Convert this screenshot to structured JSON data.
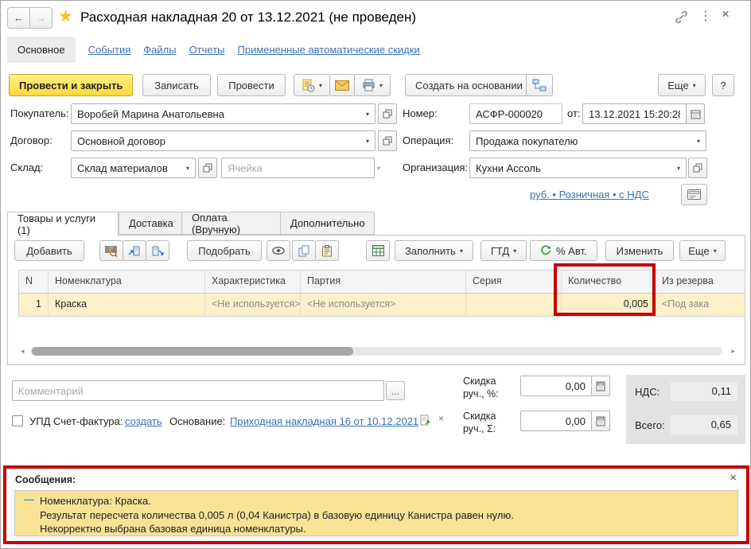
{
  "icons": {
    "back": "←",
    "forward": "→",
    "star": "★",
    "kebab": "⋮",
    "close": "×",
    "dropdown": "▾",
    "scroll_left": "◂",
    "scroll_right": "▸",
    "more_dots": "...",
    "message_dash": "—",
    "clear": "×"
  },
  "window": {
    "title": "Расходная накладная 20 от 13.12.2021 (не проведен)"
  },
  "nav_tabs": {
    "items": [
      {
        "label": "Основное"
      },
      {
        "label": "События"
      },
      {
        "label": "Файлы"
      },
      {
        "label": "Отчеты"
      },
      {
        "label": "Примененные автоматические скидки"
      }
    ]
  },
  "command_bar": {
    "post_and_close": "Провести и закрыть",
    "write": "Записать",
    "post": "Провести",
    "create_based_on": "Создать на основании",
    "more": "Еще",
    "help": "?"
  },
  "header_fields": {
    "buyer": {
      "label": "Покупатель:",
      "value": "Воробей Марина Анатольевна"
    },
    "number": {
      "label": "Номер:",
      "value": "АСФР-000020"
    },
    "date": {
      "label": "от:",
      "value": "13.12.2021 15:20:28"
    },
    "contract": {
      "label": "Договор:",
      "value": "Основной договор"
    },
    "operation": {
      "label": "Операция:",
      "value": "Продажа покупателю"
    },
    "warehouse": {
      "label": "Склад:",
      "value": "Склад материалов"
    },
    "cell": {
      "placeholder": "Ячейка"
    },
    "organization": {
      "label": "Организация:",
      "value": "Кухни Ассоль"
    },
    "price_settings_link": "руб. • Розничная • с НДС"
  },
  "doc_tabs": {
    "items": [
      {
        "label": "Товары и услуги (1)"
      },
      {
        "label": "Доставка"
      },
      {
        "label": "Оплата (Вручную)"
      },
      {
        "label": "Дополнительно"
      }
    ]
  },
  "table_toolbar": {
    "add": "Добавить",
    "pick": "Подобрать",
    "fill": "Заполнить",
    "gtd": "ГТД",
    "auto_percent": "% Авт.",
    "change": "Изменить",
    "more": "Еще"
  },
  "goods_table": {
    "headers": [
      "N",
      "Номенклатура",
      "Характеристика",
      "Партия",
      "Серия",
      "Количество",
      "Из резерва"
    ],
    "row": {
      "n": "1",
      "nomenclature": "Краска",
      "characteristic": "<Не используется>",
      "batch": "<Не используется>",
      "series": "",
      "quantity": "0,005",
      "from_reserve": "<Под зака"
    }
  },
  "footer": {
    "comment_placeholder": "Комментарий",
    "upd_label": "УПД",
    "invoice_label": "Счет-фактура:",
    "invoice_link": "создать",
    "basis_label": "Основание:",
    "basis_link": "Приходная накладная 16 от 10.12.2021",
    "discount_percent_label": "Скидка руч., %:",
    "discount_percent_value": "0,00",
    "discount_sum_label": "Скидка руч., Σ:",
    "discount_sum_value": "0,00",
    "vat_label": "НДС:",
    "vat_value": "0,11",
    "total_label": "Всего:",
    "total_value": "0,65"
  },
  "messages": {
    "title": "Сообщения:",
    "item": {
      "line1": "Номенклатура: Краска.",
      "line2": "Результат пересчета количества 0,005 л (0,04 Канистра) в базовую единицу Канистра равен нулю.",
      "line3": "Некорректно выбрана базовая единица номенклатуры."
    }
  }
}
